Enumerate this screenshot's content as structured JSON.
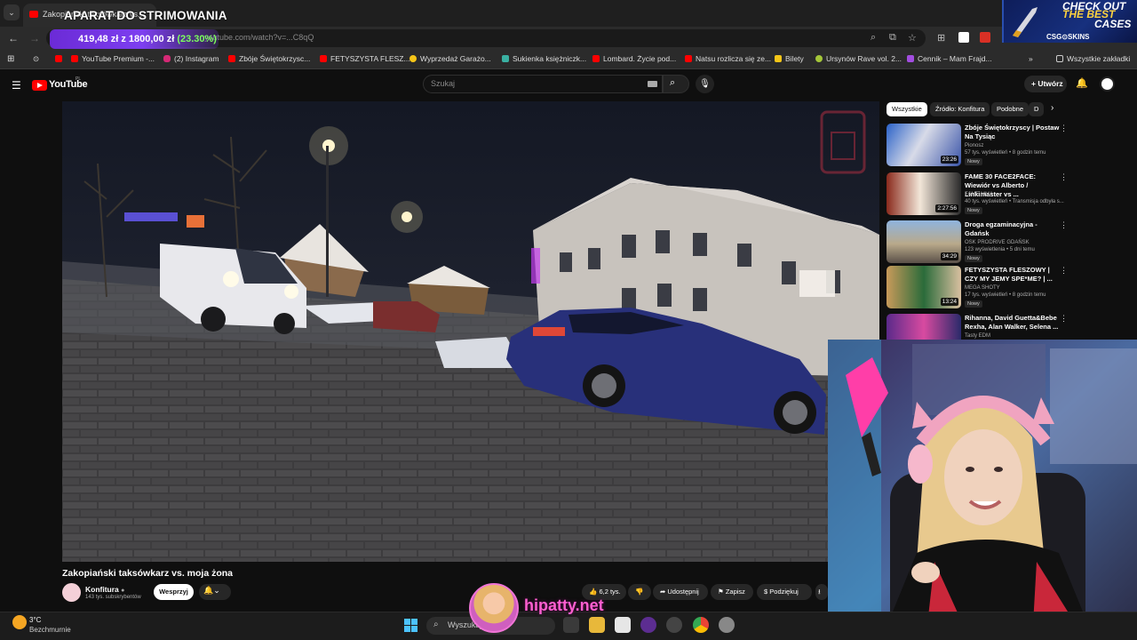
{
  "overlay": {
    "title": "APARAT DO STRIMOWANIA"
  },
  "browser": {
    "tab_title": "Zakopiański taksówkarz vs...",
    "address_text": "youtube.com/watch?v=...C8qQ",
    "donation": {
      "amount": "419,48 zł z 1800,00 zł",
      "percent": "(23.30%)"
    },
    "bookmarks": [
      "YouTube Premium -...",
      "(2) Instagram",
      "Zbóje Świętokrzysc...",
      "FETYSZYSTA FLESZ...",
      "Wyprzedaż Garażo...",
      "Sukienka księżniczk...",
      "Lombard. Życie pod...",
      "Natsu rozlicza się ze...",
      "Bilety",
      "Ursynów Rave vol. 2...",
      "Cennik – Mam Frajd..."
    ],
    "all_bookmarks": "Wszystkie zakładki"
  },
  "ad": {
    "line1": "CHECK OUT",
    "line2": "THE BEST",
    "line3": "CASES",
    "brand": "CSG⊙SKINS"
  },
  "youtube": {
    "logo": "YouTube",
    "logo_region": "PL",
    "search_placeholder": "Szukaj",
    "create": "Utwórz",
    "video": {
      "title": "Zakopiański taksówkarz vs. moja żona",
      "channel": "Konfitura",
      "subscribers": "143 tys. subskrybentów",
      "support": "Wesprzyj",
      "likes": "6,2 tys.",
      "share": "Udostępnij",
      "save": "Zapisz",
      "thanks": "Podziękuj"
    },
    "chips": [
      "Wszystkie",
      "Źródło: Konfitura",
      "Podobne",
      "D"
    ],
    "recommendations": [
      {
        "title": "Zbóje Świętokrzyscy | Postaw Na Tysiąc",
        "channel": "Pionosz",
        "meta": "57 tys. wyświetleń • 8 godzin temu",
        "badge": "Nowy",
        "duration": "23:26"
      },
      {
        "title": "FAME 30 FACE2FACE: Wiewiór vs Alberto / Linkimaster vs ...",
        "channel": "FAME MMA",
        "meta": "40 tys. wyświetleń • Transmisja odbyła s...",
        "badge": "Nowy",
        "duration": "2:27:56"
      },
      {
        "title": "Droga egzaminacyjna - Gdańsk",
        "channel": "OSK PRODRIVE GDAŃSK",
        "meta": "123 wyświetlenia • 5 dni temu",
        "badge": "Nowy",
        "duration": "34:29"
      },
      {
        "title": "FETYSZYSTA FLESZOWY | CZY MY JEMY SPE*ME? | ...",
        "channel": "MEGA SHOTY",
        "meta": "17 tys. wyświetleń • 8 godzin temu",
        "badge": "Nowy",
        "duration": "13:24"
      },
      {
        "title": "Rihanna, David Guetta&Bebe Rexha, Alan Walker, Selena ...",
        "channel": "Tasty EDM",
        "meta": "",
        "badge": "",
        "duration": ""
      }
    ]
  },
  "taskbar": {
    "temperature": "3°C",
    "weather": "Bezchmurnie",
    "search": "Wyszukaj"
  },
  "watermark": "hipatty.net"
}
